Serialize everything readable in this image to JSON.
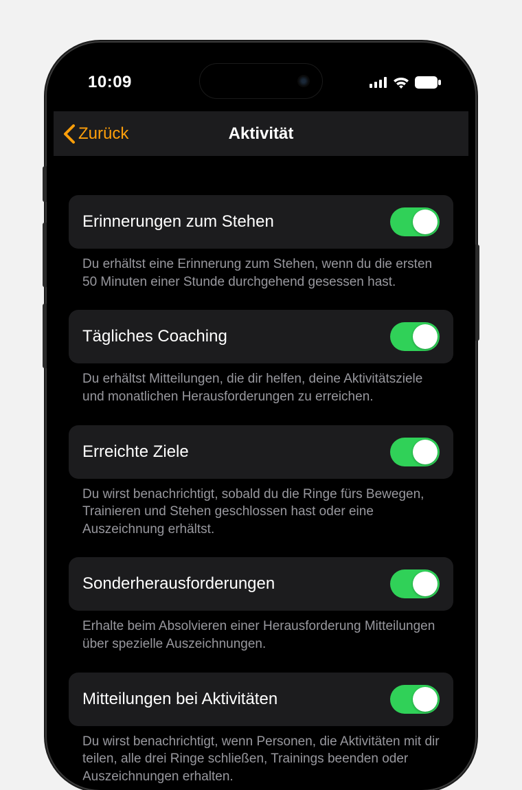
{
  "status": {
    "time": "10:09"
  },
  "nav": {
    "back_label": "Zurück",
    "title": "Aktivität"
  },
  "settings": [
    {
      "label": "Erinnerungen zum Stehen",
      "on": true,
      "desc": "Du erhältst eine Erinnerung zum Stehen, wenn du die ersten 50 Minuten einer Stunde durchgehend gesessen hast."
    },
    {
      "label": "Tägliches Coaching",
      "on": true,
      "desc": "Du erhältst Mitteilungen, die dir helfen, deine Aktivitätsziele und monatlichen Herausforderungen zu erreichen."
    },
    {
      "label": "Erreichte Ziele",
      "on": true,
      "desc": "Du wirst benachrichtigt, sobald du die Ringe fürs Bewegen, Trainieren und Stehen geschlossen hast oder eine Auszeichnung erhältst."
    },
    {
      "label": "Sonderherausforderungen",
      "on": true,
      "desc": "Erhalte beim Absolvieren einer Herausforderung Mitteilungen über spezielle Auszeichnungen."
    },
    {
      "label": "Mitteilungen bei Aktivitäten",
      "on": true,
      "desc": "Du wirst benachrichtigt, wenn Personen, die Aktivitäten mit dir teilen, alle drei Ringe schließen, Trainings beenden oder Auszeichnungen erhalten."
    }
  ],
  "colors": {
    "accent": "#ff9f0a",
    "toggle_on": "#30d158",
    "row_bg": "#1c1c1e",
    "desc_text": "#98989e"
  }
}
